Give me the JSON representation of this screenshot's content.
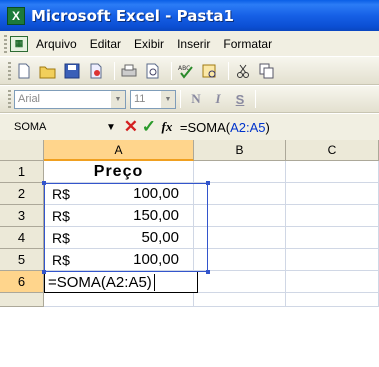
{
  "window": {
    "title": "Microsoft Excel - Pasta1",
    "app_icon": "X"
  },
  "menu": {
    "items": [
      {
        "label": "Arquivo"
      },
      {
        "label": "Editar"
      },
      {
        "label": "Exibir"
      },
      {
        "label": "Inserir"
      },
      {
        "label": "Formatar"
      }
    ]
  },
  "toolbar": {
    "icons": [
      "new-icon",
      "open-icon",
      "save-icon",
      "permission-icon",
      "print-icon",
      "print-preview-icon",
      "spelling-icon",
      "research-icon",
      "cut-icon",
      "copy-icon"
    ]
  },
  "format": {
    "font": "Arial",
    "size": "11",
    "bold": "N",
    "italic": "I",
    "underline": "S"
  },
  "formula_bar": {
    "name_box": "SOMA",
    "cancel": "✕",
    "enter": "✓",
    "fx": "fx",
    "formula_prefix": "=SOMA(",
    "formula_range": "A2:A5",
    "formula_suffix": ")"
  },
  "sheet": {
    "columns": [
      "A",
      "B",
      "C"
    ],
    "rows": [
      {
        "num": "1",
        "a_header": "Preço"
      },
      {
        "num": "2",
        "currency": "R$",
        "amount": "100,00"
      },
      {
        "num": "3",
        "currency": "R$",
        "amount": "150,00"
      },
      {
        "num": "4",
        "currency": "R$",
        "amount": "50,00"
      },
      {
        "num": "5",
        "currency": "R$",
        "amount": "100,00"
      },
      {
        "num": "6",
        "edit": "=SOMA(A2:A5)"
      }
    ]
  },
  "colors": {
    "title_bar": "#0b5ae0",
    "range_highlight": "#3355cc",
    "active_header": "#ffd58c"
  }
}
